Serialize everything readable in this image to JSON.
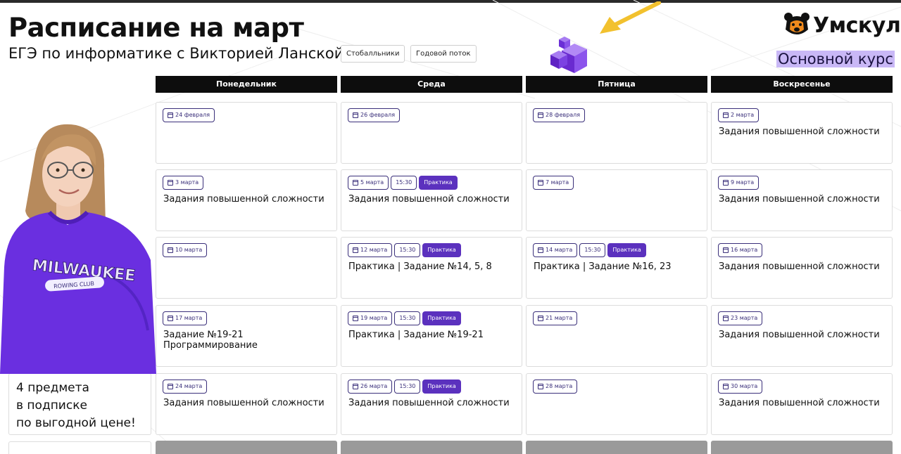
{
  "header": {
    "title": "Расписание на март",
    "subtitle": "ЕГЭ по информатике с Викторией Ланской",
    "tags": [
      "Стобалльники",
      "Годовой поток"
    ]
  },
  "brand": {
    "logo_text": "Умскул",
    "logo_icon": "bear-icon",
    "course_label": "Основной курс",
    "accent": "#5b31be",
    "highlight": "#c9b8f6"
  },
  "days": [
    "Понедельник",
    "Среда",
    "Пятница",
    "Воскресенье"
  ],
  "rows": [
    [
      {
        "date": "24 февраля",
        "text": ""
      },
      {
        "date": "26 февраля",
        "text": ""
      },
      {
        "date": "28 февраля",
        "text": ""
      },
      {
        "date": "2 марта",
        "text": "Задания повышенной сложности"
      }
    ],
    [
      {
        "date": "3 марта",
        "text": "Задания повышенной сложности"
      },
      {
        "date": "5 марта",
        "time": "15:30",
        "badge": "Практика",
        "text": "Задания повышенной сложности"
      },
      {
        "date": "7 марта",
        "text": ""
      },
      {
        "date": "9 марта",
        "text": "Задания повышенной сложности"
      }
    ],
    [
      {
        "date": "10 марта",
        "text": ""
      },
      {
        "date": "12 марта",
        "time": "15:30",
        "badge": "Практика",
        "text": "Практика | Задание №14, 5, 8"
      },
      {
        "date": "14 марта",
        "time": "15:30",
        "badge": "Практика",
        "text": "Практика | Задание №16, 23"
      },
      {
        "date": "16 марта",
        "text": "Задания повышенной сложности"
      }
    ],
    [
      {
        "date": "17 марта",
        "text": "Задание №19-21",
        "text2": "Программирование"
      },
      {
        "date": "19 марта",
        "time": "15:30",
        "badge": "Практика",
        "text": "Практика | Задание №19-21"
      },
      {
        "date": "21 марта",
        "text": ""
      },
      {
        "date": "23 марта",
        "text": "Задания повышенной сложности"
      }
    ],
    [
      {
        "date": "24 марта",
        "text": "Задания повышенной сложности"
      },
      {
        "date": "26 марта",
        "time": "15:30",
        "badge": "Практика",
        "text": "Задания повышенной сложности"
      },
      {
        "date": "28 марта",
        "text": ""
      },
      {
        "date": "30 марта",
        "text": "Задания повышенной сложности"
      }
    ]
  ],
  "promo": {
    "lines": [
      "4 предмета",
      "в подписке",
      "по выгодной цене!"
    ]
  },
  "hoodie": {
    "brand": "MILWAUKEE",
    "sub": "ROWING CLUB"
  }
}
